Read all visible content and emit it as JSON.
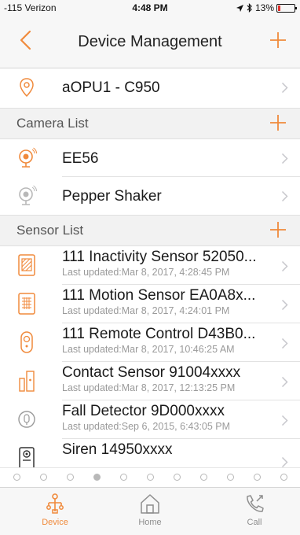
{
  "status_bar": {
    "carrier": "-115 Verizon",
    "time": "4:48 PM",
    "battery": "13%"
  },
  "nav": {
    "title": "Device Management"
  },
  "gateway": {
    "name": "aOPU1 - C950"
  },
  "camera_section": {
    "label": "Camera List"
  },
  "cameras": [
    {
      "name": "EE56",
      "icon": "camera-icon"
    },
    {
      "name": "Pepper Shaker",
      "icon": "camera-icon"
    }
  ],
  "sensor_section": {
    "label": "Sensor List"
  },
  "sensors": [
    {
      "name": "111 Inactivity Sensor 52050...",
      "updated": "Last updated:Mar 8, 2017, 4:28:45 PM",
      "icon": "inactivity-sensor-icon"
    },
    {
      "name": "111 Motion Sensor EA0A8x...",
      "updated": "Last updated:Mar 8, 2017, 4:24:01 PM",
      "icon": "motion-sensor-icon"
    },
    {
      "name": "111 Remote Control D43B0...",
      "updated": "Last updated:Mar 8, 2017, 10:46:25 AM",
      "icon": "remote-control-icon"
    },
    {
      "name": "Contact Sensor 91004xxxx",
      "updated": "Last updated:Mar 8, 2017, 12:13:25 PM",
      "icon": "contact-sensor-icon"
    },
    {
      "name": "Fall Detector 9D000xxxx",
      "updated": "Last updated:Sep 6, 2015, 6:43:05 PM",
      "icon": "fall-detector-icon"
    },
    {
      "name": "Siren 14950xxxx",
      "updated": "",
      "icon": "siren-icon"
    }
  ],
  "page_dots": {
    "count": 11,
    "active_index": 3
  },
  "tabs": [
    {
      "label": "Device",
      "icon": "device-icon",
      "active": true
    },
    {
      "label": "Home",
      "icon": "home-icon",
      "active": false
    },
    {
      "label": "Call",
      "icon": "call-icon",
      "active": false
    }
  ],
  "colors": {
    "accent": "#f08a3c",
    "section_bg": "#f2f2f2",
    "subtext": "#9a9a9a",
    "chevron": "#c7c7cc"
  }
}
